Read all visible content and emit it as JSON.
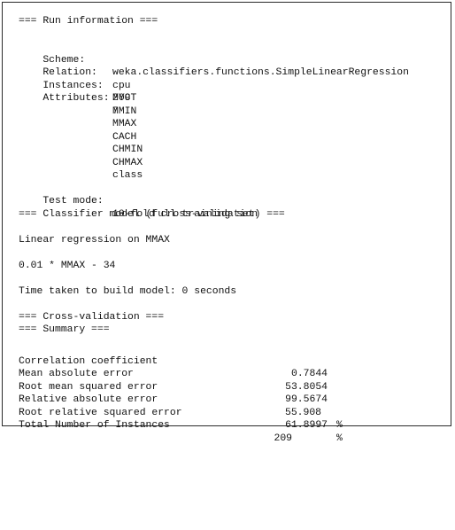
{
  "run_info_header": "=== Run information ===",
  "run_info": {
    "scheme": {
      "label": "Scheme:",
      "value": "weka.classifiers.functions.SimpleLinearRegression"
    },
    "relation": {
      "label": "Relation:",
      "value": "cpu"
    },
    "instances": {
      "label": "Instances:",
      "value": "209"
    },
    "attributes": {
      "label": "Attributes:",
      "count": "7",
      "list": [
        "MYCT",
        "MMIN",
        "MMAX",
        "CACH",
        "CHMIN",
        "CHMAX",
        "class"
      ]
    },
    "test_mode": {
      "label": "Test mode:",
      "value": "10-fold cross-validation"
    }
  },
  "classifier_header": "=== Classifier model (full training set) ===",
  "model_title": "Linear regression on MMAX",
  "model_equation": "0.01 * MMAX - 34",
  "time_taken": "Time taken to build model: 0 seconds",
  "cv_header": "=== Cross-validation ===",
  "summary_header": "=== Summary ===",
  "summary": [
    {
      "label": "Correlation coefficient",
      "value": "0.7844",
      "unit": ""
    },
    {
      "label": "Mean absolute error",
      "value": "53.8054",
      "unit": ""
    },
    {
      "label": "Root mean squared error",
      "value": "99.5674",
      "unit": ""
    },
    {
      "label": "Relative absolute error",
      "value": "55.908",
      "unit": "%"
    },
    {
      "label": "Root relative squared error",
      "value": "61.8997",
      "unit": "%"
    },
    {
      "label": "Total Number of Instances",
      "value": "209",
      "unit": ""
    }
  ]
}
